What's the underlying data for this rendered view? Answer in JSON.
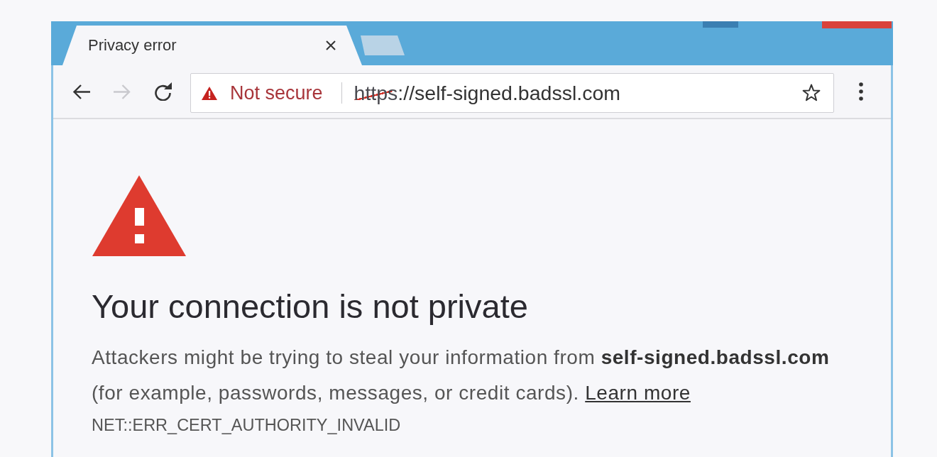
{
  "window": {
    "tabs": [
      {
        "title": "Privacy error",
        "selected": true
      }
    ]
  },
  "toolbar": {
    "back": {
      "disabled": false
    },
    "forward": {
      "disabled": true
    }
  },
  "address_bar": {
    "security": {
      "kind": "warning",
      "label": "Not secure"
    },
    "url": {
      "scheme": "https",
      "rest": "://self-signed.badssl.com",
      "scheme_struck": true
    }
  },
  "error_page": {
    "heading": "Your connection is not private",
    "description": "Attackers might be trying to steal your information from **self-signed.badssl.com** (for example, passwords, messages, or credit cards).",
    "learn_more": "Learn more",
    "error_code": "NET::ERR_CERT_AUTHORITY_INVALID"
  }
}
